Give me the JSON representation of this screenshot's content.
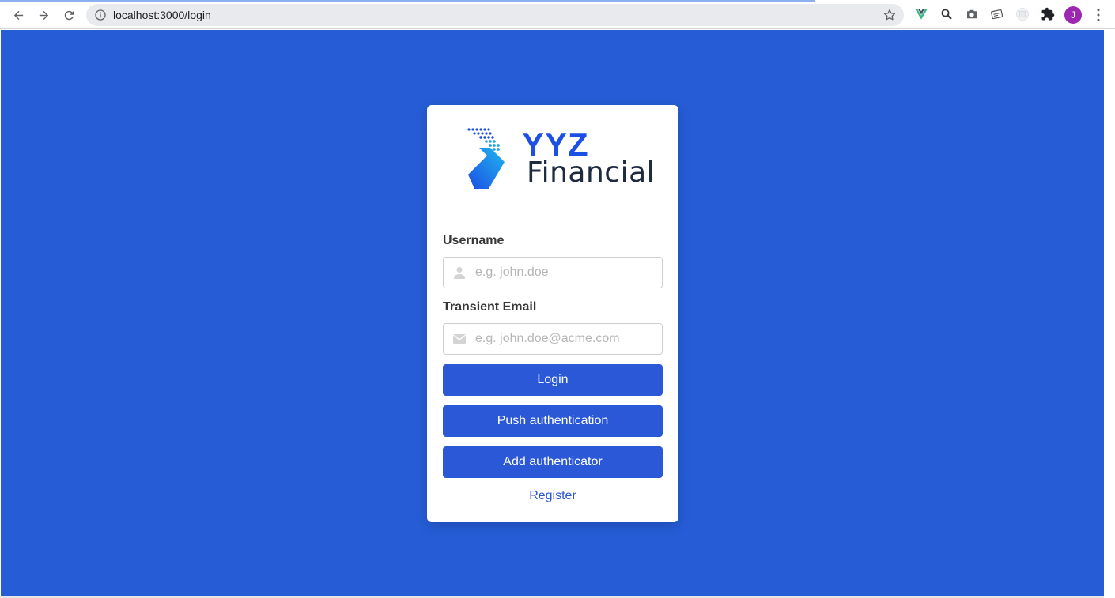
{
  "browser": {
    "url": "localhost:3000/login",
    "profile_initial": "J",
    "accent_color": "#9c27b0"
  },
  "brand": {
    "logo_line1": "YYZ",
    "logo_line2": "Financial",
    "primary_color": "#265dd6"
  },
  "form": {
    "username_label": "Username",
    "username_placeholder": "e.g. john.doe",
    "username_value": "",
    "email_label": "Transient Email",
    "email_placeholder": "e.g. john.doe@acme.com",
    "email_value": "",
    "login_label": "Login",
    "push_label": "Push authentication",
    "add_auth_label": "Add authenticator",
    "register_label": "Register"
  },
  "icons": {
    "back": "arrow-left-icon",
    "forward": "arrow-right-icon",
    "reload": "reload-icon",
    "info": "info-icon",
    "bookmark": "star-icon",
    "user": "user-icon",
    "email": "envelope-icon"
  }
}
